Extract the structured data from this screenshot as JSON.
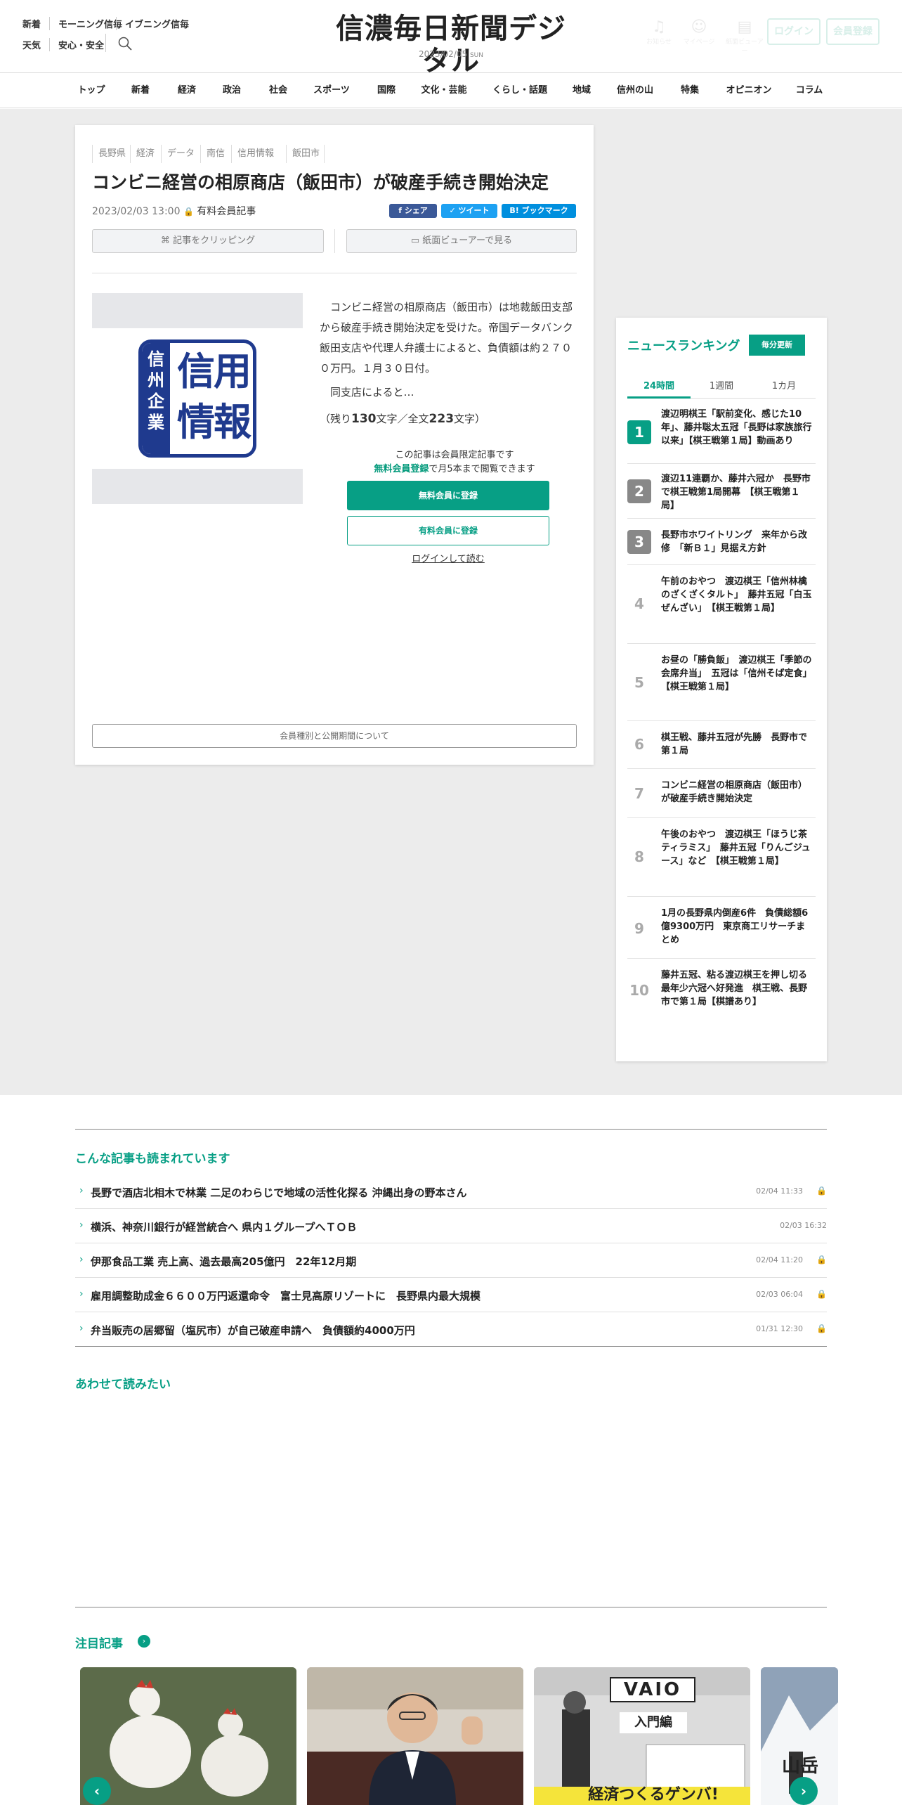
{
  "header": {
    "links_row1": [
      "新着",
      "モーニング信毎",
      "イブニング信毎"
    ],
    "links_row2": [
      "天気",
      "安心・安全"
    ],
    "logo": "信濃毎日新聞デジタル",
    "date": "2023/02/05",
    "weekday": "SUN",
    "icons": [
      {
        "icon": "bell-icon",
        "label": "お知らせ"
      },
      {
        "icon": "user-icon",
        "label": "マイページ"
      },
      {
        "icon": "newspaper-icon",
        "label": "紙面ビューアー"
      }
    ],
    "login_label": "ログイン",
    "register_label": "会員登録"
  },
  "nav": [
    "トップ",
    "新着",
    "経済",
    "政治",
    "社会",
    "スポーツ",
    "国際",
    "文化・芸能",
    "くらし・話題",
    "地域",
    "信州の山",
    "特集",
    "オピニオン",
    "コラム"
  ],
  "article": {
    "tags": [
      "長野県",
      "経済",
      "データ",
      "南信",
      "信用情報",
      "飯田市"
    ],
    "title": "コンビニ経営の相原商店（飯田市）が破産手続き開始決定",
    "date": "2023/02/03 13:00",
    "membership": "有料会員記事",
    "share": {
      "facebook": "シェア",
      "twitter": "ツイート",
      "hatena": "ブックマーク"
    },
    "clip_label": "記事をクリッピング",
    "viewer_label": "紙面ビューアーで見る",
    "badge_left": "信州企業",
    "badge_right": "信用情報",
    "body1": "コンビニ経営の相原商店（飯田市）は地裁飯田支部から破産手続き開始決定を受けた。帝国データバンク飯田支店や代理人弁護士によると、負債額は約２７００万円。１月３０日付。",
    "body2": "同支店によると…",
    "remain_prefix": "（残り",
    "remain_count": "130",
    "remain_mid": "文字／全文",
    "total_count": "223",
    "remain_suffix": "文字）",
    "limit_line1": "この記事は会員限定記事です",
    "limit_link": "無料会員登録",
    "limit_line2": "で月5本まで閲覧できます",
    "free_button": "無料会員に登録",
    "paid_button": "有料会員に登録",
    "login_link": "ログインして読む",
    "member_info": "会員種別と公開期間について"
  },
  "ranking": {
    "title": "ニュースランキング",
    "update_label": "毎分更新",
    "tabs": [
      "24時間",
      "1週間",
      "1カ月"
    ],
    "items": [
      {
        "rank": "1",
        "text": "渡辺明棋王「駅前変化、感じた10年」、藤井聡太五冠「長野は家族旅行以来」【棋王戦第１局】動画あり"
      },
      {
        "rank": "2",
        "text": "渡辺11連覇か、藤井六冠か　長野市で棋王戦第1局開幕　【棋王戦第１局】"
      },
      {
        "rank": "3",
        "text": "長野市ホワイトリング　来年から改修　「新Ｂ１」見据え方針"
      },
      {
        "rank": "4",
        "text": "午前のおやつ　渡辺棋王「信州林檎のざくざくタルト」　藤井五冠「白玉ぜんざい」　【棋王戦第１局】"
      },
      {
        "rank": "5",
        "text": "お昼の「勝負飯」　渡辺棋王「季節の会席弁当」　五冠は「信州そば定食」　【棋王戦第１局】"
      },
      {
        "rank": "6",
        "text": "棋王戦、藤井五冠が先勝　長野市で第１局"
      },
      {
        "rank": "7",
        "text": "コンビニ経営の相原商店（飯田市）が破産手続き開始決定"
      },
      {
        "rank": "8",
        "text": "午後のおやつ　渡辺棋王「ほうじ茶ティラミス」　藤井五冠「りんごジュース」など　【棋王戦第１局】"
      },
      {
        "rank": "9",
        "text": "1月の長野県内倒産6件　負債総額6億9300万円　東京商工リサーチまとめ"
      },
      {
        "rank": "10",
        "text": "藤井五冠、粘る渡辺棋王を押し切る　最年少六冠へ好発進　棋王戦、長野市で第１局【棋譜あり】"
      }
    ]
  },
  "related": {
    "title": "こんな記事も読まれています",
    "items": [
      {
        "text": "長野で酒店北相木で林業 二足のわらじで地域の活性化探る 沖縄出身の野本さん",
        "date": "02/04 11:33",
        "lock": true
      },
      {
        "text": "横浜、神奈川銀行が経営統合へ 県内１グループへＴＯＢ",
        "date": "02/03 16:32",
        "lock": false
      },
      {
        "text": "伊那食品工業 売上高、過去最高205億円　22年12月期",
        "date": "02/04 11:20",
        "lock": true
      },
      {
        "text": "雇用調整助成金６６００万円返還命令　富士見高原リゾートに　長野県内最大規模",
        "date": "02/03 06:04",
        "lock": true
      },
      {
        "text": "弁当販売の居郷留（塩尻市）が自己破産申請へ　負債額約4000万円",
        "date": "01/31 12:30",
        "lock": true
      }
    ]
  },
  "also_read": {
    "title": "あわせて読みたい"
  },
  "featured": {
    "title": "注目記事",
    "cards": [
      {
        "alt": "white-hens-photo"
      },
      {
        "alt": "man-portrait-photo"
      },
      {
        "alt": "vaio-factory-photo",
        "label1": "VAIO",
        "label2": "入門編",
        "label3": "経済つくるゲンバ!"
      },
      {
        "alt": "snow-mountain-photo",
        "label1": "山岳"
      }
    ]
  },
  "colors": {
    "accent": "#079f85",
    "badge": "#1f3a8e",
    "facebook": "#3b5998",
    "twitter": "#1da1f2",
    "hatena": "#008fde"
  }
}
